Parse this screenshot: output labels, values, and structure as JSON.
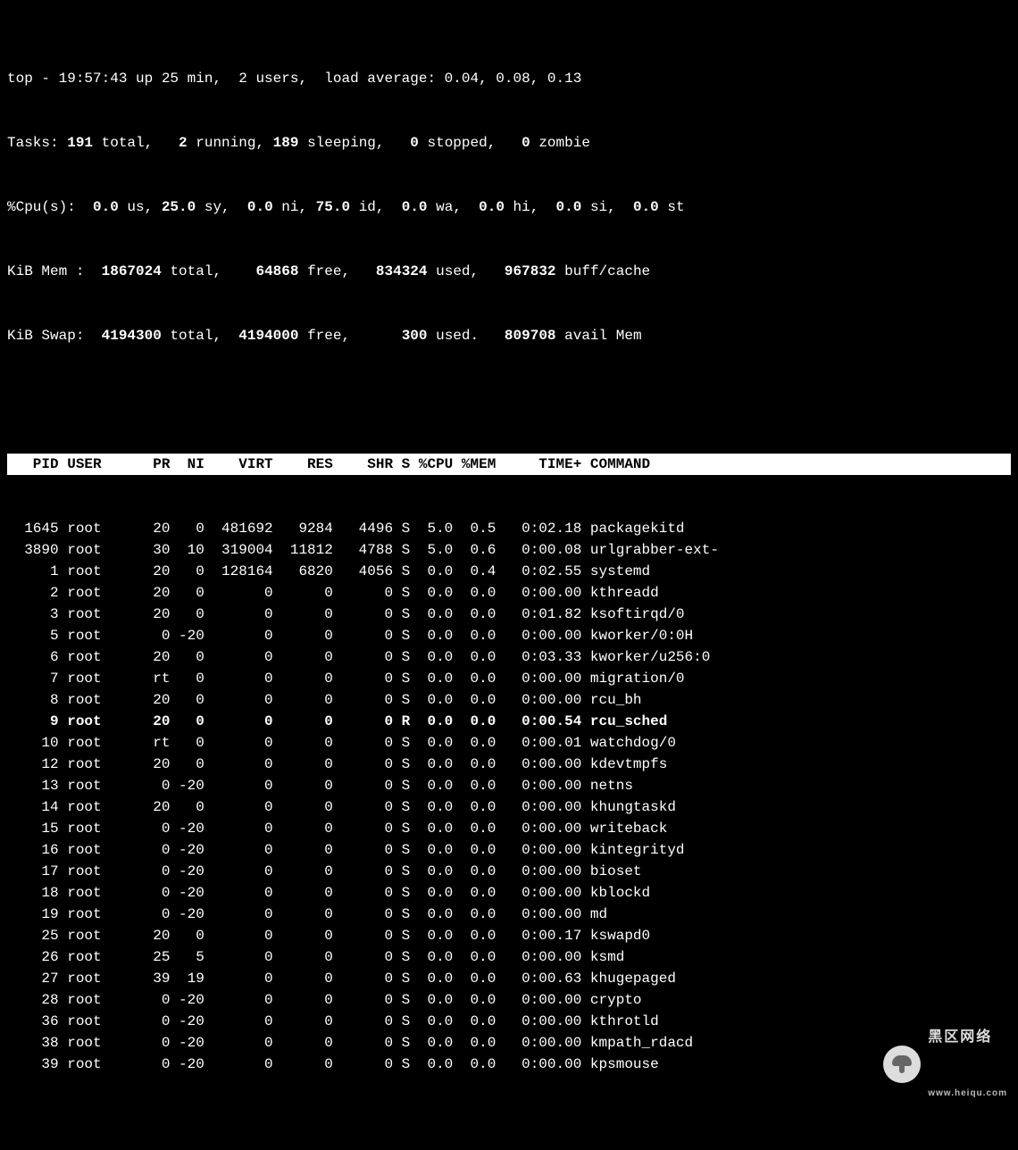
{
  "header": {
    "line1_plain1": "top - 19:57:43 up 25 min,  2 users,  load average: 0.04, 0.08, 0.13",
    "tasks_label": "Tasks: ",
    "tasks_total": "191 ",
    "tasks_total_suffix": "total,   ",
    "tasks_running": "2 ",
    "tasks_running_suffix": "running, ",
    "tasks_sleeping": "189 ",
    "tasks_sleeping_suffix": "sleeping,   ",
    "tasks_stopped": "0 ",
    "tasks_stopped_suffix": "stopped,   ",
    "tasks_zombie": "0 ",
    "tasks_zombie_suffix": "zombie",
    "cpu_label": "%Cpu(s):  ",
    "cpu_us": "0.0 ",
    "cpu_us_suffix": "us, ",
    "cpu_sy": "25.0 ",
    "cpu_sy_suffix": "sy,  ",
    "cpu_ni": "0.0 ",
    "cpu_ni_suffix": "ni, ",
    "cpu_id": "75.0 ",
    "cpu_id_suffix": "id,  ",
    "cpu_wa": "0.0 ",
    "cpu_wa_suffix": "wa,  ",
    "cpu_hi": "0.0 ",
    "cpu_hi_suffix": "hi,  ",
    "cpu_si": "0.0 ",
    "cpu_si_suffix": "si,  ",
    "cpu_st": "0.0 ",
    "cpu_st_suffix": "st",
    "mem_label": "KiB Mem : ",
    "mem_total": " 1867024 ",
    "mem_total_suffix": "total,   ",
    "mem_free": " 64868 ",
    "mem_free_suffix": "free,   ",
    "mem_used": "834324 ",
    "mem_used_suffix": "used,   ",
    "mem_buff": "967832 ",
    "mem_buff_suffix": "buff/cache",
    "swap_label": "KiB Swap: ",
    "swap_total": " 4194300 ",
    "swap_total_suffix": "total,  ",
    "swap_free": "4194000 ",
    "swap_free_suffix": "free,      ",
    "swap_used": "300 ",
    "swap_used_suffix": "used.   ",
    "swap_avail": "809708 ",
    "swap_avail_suffix": "avail Mem "
  },
  "columns": "   PID USER      PR  NI    VIRT    RES    SHR S %CPU %MEM     TIME+ COMMAND                                 ",
  "rows": [
    {
      "pid": "1645",
      "user": "root",
      "pr": "20",
      "ni": "0",
      "virt": "481692",
      "res": "9284",
      "shr": "4496",
      "s": "S",
      "cpu": "5.0",
      "mem": "0.5",
      "time": "0:02.18",
      "cmd": "packagekitd",
      "bold": false
    },
    {
      "pid": "3890",
      "user": "root",
      "pr": "30",
      "ni": "10",
      "virt": "319004",
      "res": "11812",
      "shr": "4788",
      "s": "S",
      "cpu": "5.0",
      "mem": "0.6",
      "time": "0:00.08",
      "cmd": "urlgrabber-ext-",
      "bold": false
    },
    {
      "pid": "1",
      "user": "root",
      "pr": "20",
      "ni": "0",
      "virt": "128164",
      "res": "6820",
      "shr": "4056",
      "s": "S",
      "cpu": "0.0",
      "mem": "0.4",
      "time": "0:02.55",
      "cmd": "systemd",
      "bold": false
    },
    {
      "pid": "2",
      "user": "root",
      "pr": "20",
      "ni": "0",
      "virt": "0",
      "res": "0",
      "shr": "0",
      "s": "S",
      "cpu": "0.0",
      "mem": "0.0",
      "time": "0:00.00",
      "cmd": "kthreadd",
      "bold": false
    },
    {
      "pid": "3",
      "user": "root",
      "pr": "20",
      "ni": "0",
      "virt": "0",
      "res": "0",
      "shr": "0",
      "s": "S",
      "cpu": "0.0",
      "mem": "0.0",
      "time": "0:01.82",
      "cmd": "ksoftirqd/0",
      "bold": false
    },
    {
      "pid": "5",
      "user": "root",
      "pr": "0",
      "ni": "-20",
      "virt": "0",
      "res": "0",
      "shr": "0",
      "s": "S",
      "cpu": "0.0",
      "mem": "0.0",
      "time": "0:00.00",
      "cmd": "kworker/0:0H",
      "bold": false
    },
    {
      "pid": "6",
      "user": "root",
      "pr": "20",
      "ni": "0",
      "virt": "0",
      "res": "0",
      "shr": "0",
      "s": "S",
      "cpu": "0.0",
      "mem": "0.0",
      "time": "0:03.33",
      "cmd": "kworker/u256:0",
      "bold": false
    },
    {
      "pid": "7",
      "user": "root",
      "pr": "rt",
      "ni": "0",
      "virt": "0",
      "res": "0",
      "shr": "0",
      "s": "S",
      "cpu": "0.0",
      "mem": "0.0",
      "time": "0:00.00",
      "cmd": "migration/0",
      "bold": false
    },
    {
      "pid": "8",
      "user": "root",
      "pr": "20",
      "ni": "0",
      "virt": "0",
      "res": "0",
      "shr": "0",
      "s": "S",
      "cpu": "0.0",
      "mem": "0.0",
      "time": "0:00.00",
      "cmd": "rcu_bh",
      "bold": false
    },
    {
      "pid": "9",
      "user": "root",
      "pr": "20",
      "ni": "0",
      "virt": "0",
      "res": "0",
      "shr": "0",
      "s": "R",
      "cpu": "0.0",
      "mem": "0.0",
      "time": "0:00.54",
      "cmd": "rcu_sched",
      "bold": true
    },
    {
      "pid": "10",
      "user": "root",
      "pr": "rt",
      "ni": "0",
      "virt": "0",
      "res": "0",
      "shr": "0",
      "s": "S",
      "cpu": "0.0",
      "mem": "0.0",
      "time": "0:00.01",
      "cmd": "watchdog/0",
      "bold": false
    },
    {
      "pid": "12",
      "user": "root",
      "pr": "20",
      "ni": "0",
      "virt": "0",
      "res": "0",
      "shr": "0",
      "s": "S",
      "cpu": "0.0",
      "mem": "0.0",
      "time": "0:00.00",
      "cmd": "kdevtmpfs",
      "bold": false
    },
    {
      "pid": "13",
      "user": "root",
      "pr": "0",
      "ni": "-20",
      "virt": "0",
      "res": "0",
      "shr": "0",
      "s": "S",
      "cpu": "0.0",
      "mem": "0.0",
      "time": "0:00.00",
      "cmd": "netns",
      "bold": false
    },
    {
      "pid": "14",
      "user": "root",
      "pr": "20",
      "ni": "0",
      "virt": "0",
      "res": "0",
      "shr": "0",
      "s": "S",
      "cpu": "0.0",
      "mem": "0.0",
      "time": "0:00.00",
      "cmd": "khungtaskd",
      "bold": false
    },
    {
      "pid": "15",
      "user": "root",
      "pr": "0",
      "ni": "-20",
      "virt": "0",
      "res": "0",
      "shr": "0",
      "s": "S",
      "cpu": "0.0",
      "mem": "0.0",
      "time": "0:00.00",
      "cmd": "writeback",
      "bold": false
    },
    {
      "pid": "16",
      "user": "root",
      "pr": "0",
      "ni": "-20",
      "virt": "0",
      "res": "0",
      "shr": "0",
      "s": "S",
      "cpu": "0.0",
      "mem": "0.0",
      "time": "0:00.00",
      "cmd": "kintegrityd",
      "bold": false
    },
    {
      "pid": "17",
      "user": "root",
      "pr": "0",
      "ni": "-20",
      "virt": "0",
      "res": "0",
      "shr": "0",
      "s": "S",
      "cpu": "0.0",
      "mem": "0.0",
      "time": "0:00.00",
      "cmd": "bioset",
      "bold": false
    },
    {
      "pid": "18",
      "user": "root",
      "pr": "0",
      "ni": "-20",
      "virt": "0",
      "res": "0",
      "shr": "0",
      "s": "S",
      "cpu": "0.0",
      "mem": "0.0",
      "time": "0:00.00",
      "cmd": "kblockd",
      "bold": false
    },
    {
      "pid": "19",
      "user": "root",
      "pr": "0",
      "ni": "-20",
      "virt": "0",
      "res": "0",
      "shr": "0",
      "s": "S",
      "cpu": "0.0",
      "mem": "0.0",
      "time": "0:00.00",
      "cmd": "md",
      "bold": false
    },
    {
      "pid": "25",
      "user": "root",
      "pr": "20",
      "ni": "0",
      "virt": "0",
      "res": "0",
      "shr": "0",
      "s": "S",
      "cpu": "0.0",
      "mem": "0.0",
      "time": "0:00.17",
      "cmd": "kswapd0",
      "bold": false
    },
    {
      "pid": "26",
      "user": "root",
      "pr": "25",
      "ni": "5",
      "virt": "0",
      "res": "0",
      "shr": "0",
      "s": "S",
      "cpu": "0.0",
      "mem": "0.0",
      "time": "0:00.00",
      "cmd": "ksmd",
      "bold": false
    },
    {
      "pid": "27",
      "user": "root",
      "pr": "39",
      "ni": "19",
      "virt": "0",
      "res": "0",
      "shr": "0",
      "s": "S",
      "cpu": "0.0",
      "mem": "0.0",
      "time": "0:00.63",
      "cmd": "khugepaged",
      "bold": false
    },
    {
      "pid": "28",
      "user": "root",
      "pr": "0",
      "ni": "-20",
      "virt": "0",
      "res": "0",
      "shr": "0",
      "s": "S",
      "cpu": "0.0",
      "mem": "0.0",
      "time": "0:00.00",
      "cmd": "crypto",
      "bold": false
    },
    {
      "pid": "36",
      "user": "root",
      "pr": "0",
      "ni": "-20",
      "virt": "0",
      "res": "0",
      "shr": "0",
      "s": "S",
      "cpu": "0.0",
      "mem": "0.0",
      "time": "0:00.00",
      "cmd": "kthrotld",
      "bold": false
    },
    {
      "pid": "38",
      "user": "root",
      "pr": "0",
      "ni": "-20",
      "virt": "0",
      "res": "0",
      "shr": "0",
      "s": "S",
      "cpu": "0.0",
      "mem": "0.0",
      "time": "0:00.00",
      "cmd": "kmpath_rdacd",
      "bold": false
    },
    {
      "pid": "39",
      "user": "root",
      "pr": "0",
      "ni": "-20",
      "virt": "0",
      "res": "0",
      "shr": "0",
      "s": "S",
      "cpu": "0.0",
      "mem": "0.0",
      "time": "0:00.00",
      "cmd": "kpsmouse",
      "bold": false
    }
  ],
  "watermark": {
    "line1": "黑区网络",
    "line2": "www.heiqu.com"
  }
}
